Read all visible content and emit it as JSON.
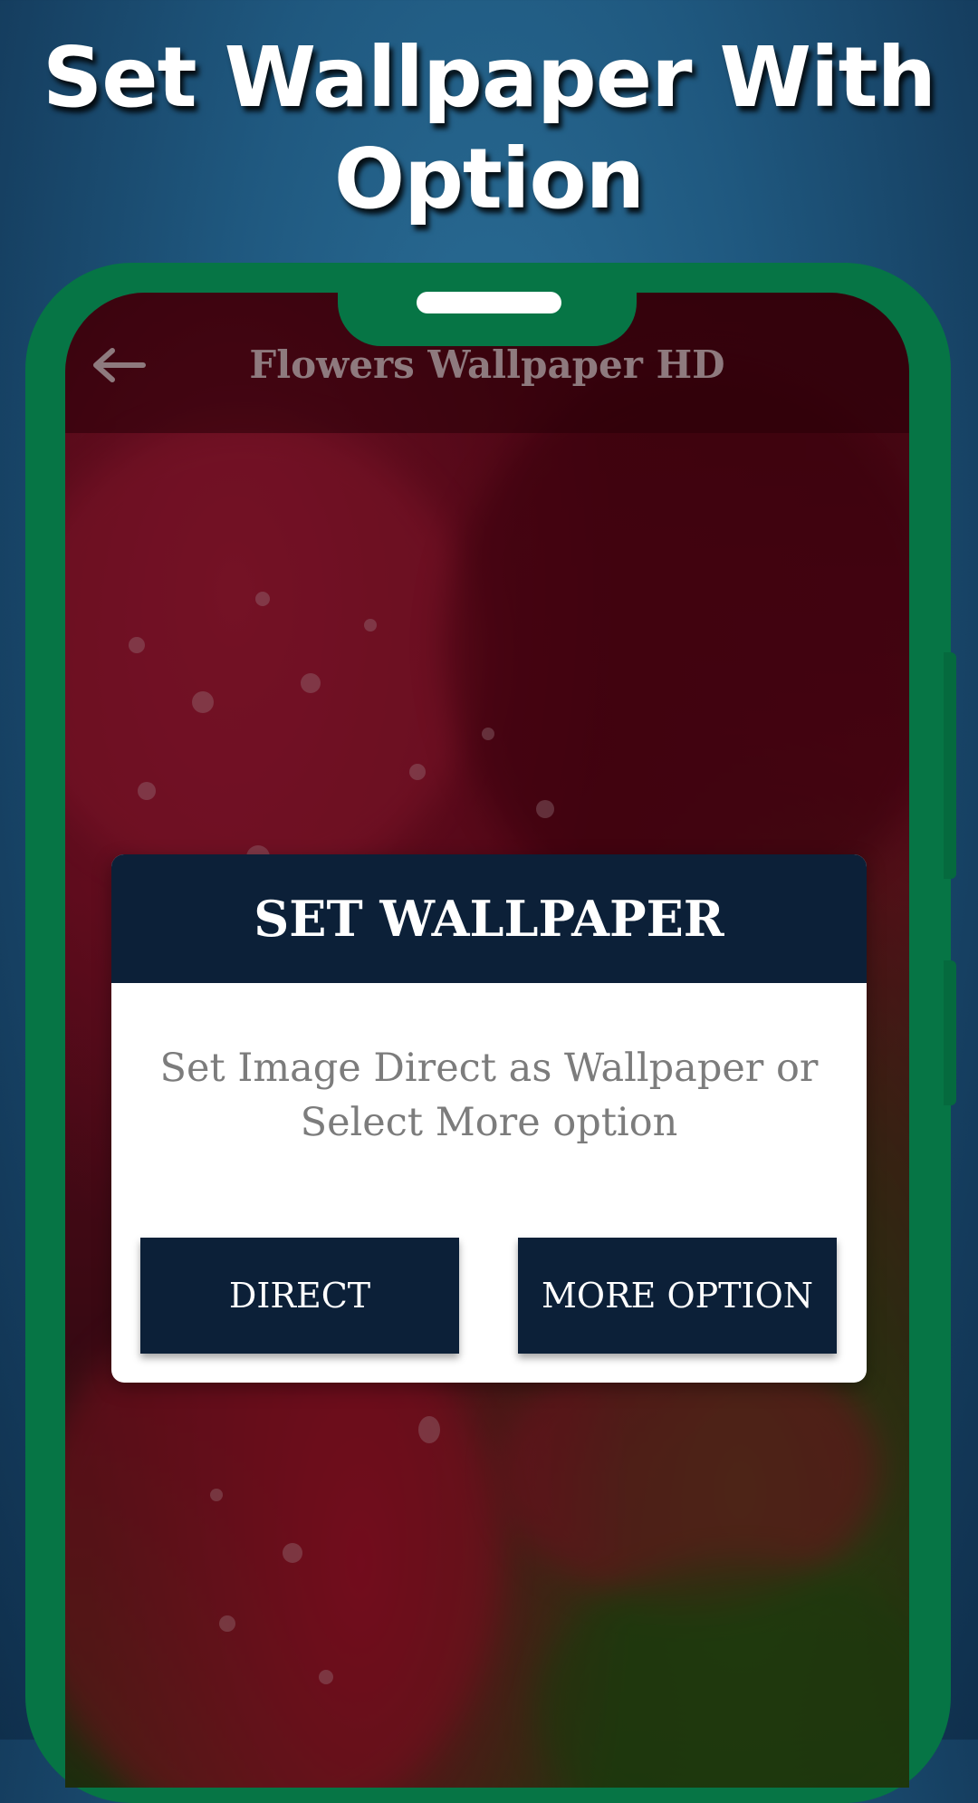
{
  "headline": {
    "line1": "Set Wallpaper With",
    "line2": "Option"
  },
  "app_bar": {
    "back_icon": "arrow-left-icon",
    "title": "Flowers Wallpaper HD"
  },
  "dialog": {
    "title": "SET WALLPAPER",
    "message_line1": "Set Image Direct as Wallpaper or",
    "message_line2": "Select More option",
    "direct_label": "DIRECT",
    "more_option_label": "MORE OPTION"
  },
  "colors": {
    "phone_frame": "#067545",
    "dialog_header": "#0c2038",
    "button": "#0c2038",
    "background": "#1f587f"
  }
}
